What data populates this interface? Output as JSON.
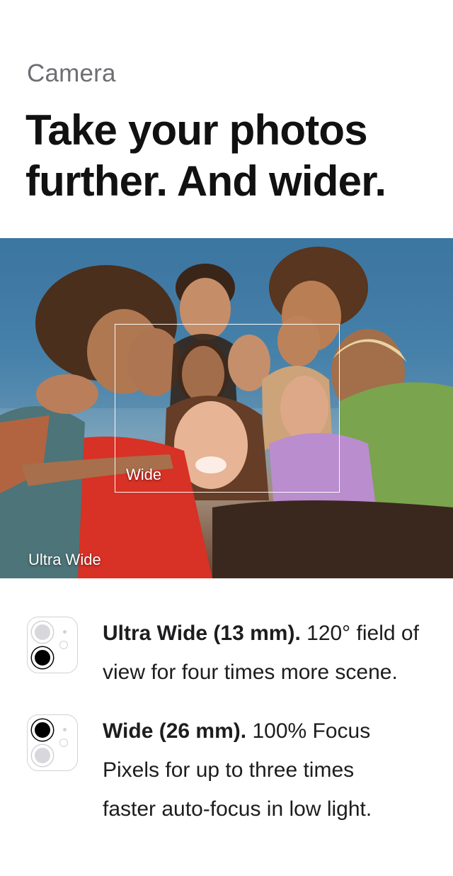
{
  "header": {
    "eyebrow": "Camera",
    "headline_line1": "Take your photos",
    "headline_line2": "further. And wider."
  },
  "photo": {
    "wide_label": "Wide",
    "ultra_wide_label": "Ultra Wide"
  },
  "features": [
    {
      "title": "Ultra Wide (13 mm).",
      "line1_rest": " 120° field of",
      "line2": "view for four times more scene.",
      "icon": "dual-camera-ultra-wide-icon",
      "active_lens": "bottom"
    },
    {
      "title": "Wide (26 mm).",
      "line1_rest": " 100% Focus",
      "line2": "Pixels for up to three times",
      "line3": "faster auto-focus in low light.",
      "icon": "dual-camera-wide-icon",
      "active_lens": "top"
    }
  ],
  "colors": {
    "eyebrow": "#6e6e73",
    "headline": "#111111",
    "body": "#1d1d1f",
    "frame": "#ffffff"
  }
}
